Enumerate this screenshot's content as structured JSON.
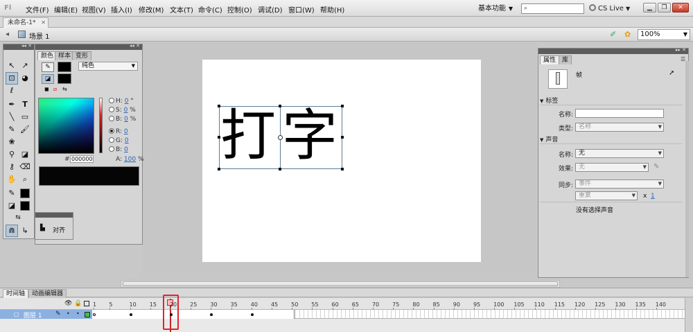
{
  "app": {
    "logo": "Fl"
  },
  "menu": {
    "items": [
      "文件(F)",
      "编辑(E)",
      "视图(V)",
      "插入(I)",
      "修改(M)",
      "文本(T)",
      "命令(C)",
      "控制(O)",
      "调试(D)",
      "窗口(W)",
      "帮助(H)"
    ]
  },
  "workspace": {
    "label": "基本功能"
  },
  "search": {
    "placeholder": ""
  },
  "cslive": {
    "label": "CS Live"
  },
  "document": {
    "tab": "未命名-1*"
  },
  "scene": {
    "label": "场景 1"
  },
  "zoom": {
    "value": "100%"
  },
  "stage": {
    "chars": [
      "打",
      "字"
    ]
  },
  "color_panel": {
    "tabs": [
      "颜色",
      "样本",
      "变形"
    ],
    "fill_type": "纯色",
    "hsb": {
      "h_label": "H:",
      "h": "0",
      "h_unit": "°",
      "s_label": "S:",
      "s": "0",
      "s_unit": "%",
      "b_label": "B:",
      "b": "0",
      "b_unit": "%"
    },
    "rgb": {
      "r_label": "R:",
      "r": "0",
      "g_label": "G:",
      "g": "0",
      "b_label": "B:",
      "b": "0"
    },
    "hex_label": "#",
    "hex": "000000",
    "alpha_label": "A:",
    "alpha": "100",
    "alpha_unit": "%",
    "swatch_color": "#000000"
  },
  "align_panel": {
    "label": "对齐"
  },
  "properties": {
    "tabs": [
      "属性",
      "库"
    ],
    "type_label": "帧",
    "label_section": "标签",
    "name_label": "名称:",
    "name_value": "",
    "type_field_label": "类型:",
    "type_value": "名称",
    "sound_section": "声音",
    "sound_name_label": "名称:",
    "sound_name_value": "无",
    "effect_label": "效果:",
    "effect_value": "无",
    "sync_label": "同步:",
    "sync_value": "事件",
    "repeat_value": "重复",
    "repeat_x": "x",
    "repeat_count": "1",
    "no_sound": "没有选择声音"
  },
  "timeline": {
    "tabs": [
      "时间轴",
      "动画编辑器"
    ],
    "layer_name": "图层 1",
    "frame_numbers": [
      "1",
      "5",
      "10",
      "15",
      "20",
      "25",
      "30",
      "35",
      "40",
      "45",
      "50",
      "55",
      "60",
      "65",
      "70",
      "75",
      "80",
      "85",
      "90",
      "95",
      "100",
      "105",
      "110",
      "115",
      "120",
      "125",
      "130",
      "135",
      "140"
    ],
    "current_frame": 20,
    "total_frames": 50,
    "keyframes": [
      1,
      10,
      20,
      30,
      40
    ]
  },
  "colors": {
    "accent": "#8bb0e1",
    "playhead": "#c0262a",
    "highlight_box": "#e2222c"
  }
}
